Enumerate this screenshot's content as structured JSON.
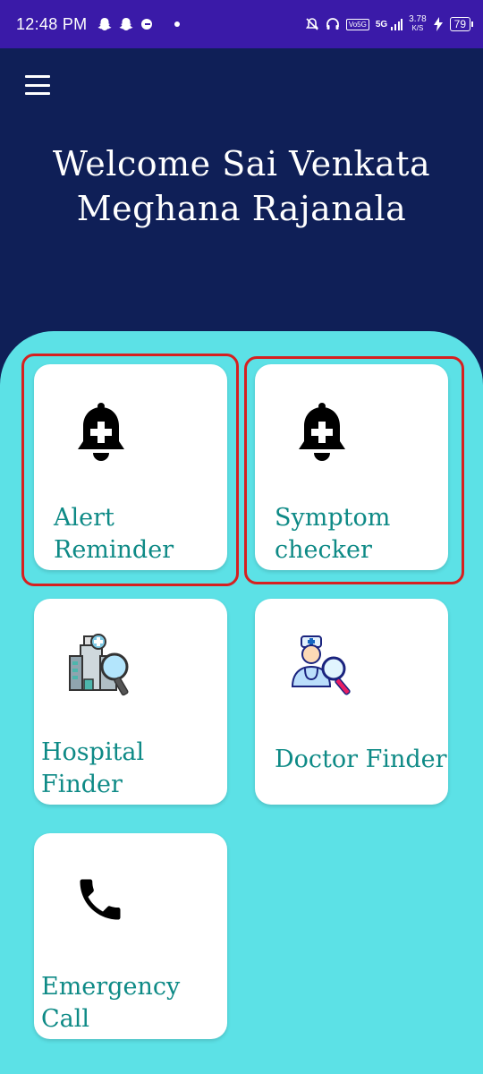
{
  "status_bar": {
    "time": "12:48 PM",
    "network_label": "5G",
    "volte_label": "Vo5G",
    "speed_value": "3.78",
    "speed_unit": "K/S",
    "battery": "79"
  },
  "header": {
    "title_line1": "Welcome Sai Venkata",
    "title_line2": "Meghana Rajanala"
  },
  "cards": [
    {
      "label_line1": "Alert",
      "label_line2": "Reminder",
      "icon": "bell-plus-icon",
      "highlighted": true
    },
    {
      "label_line1": "Symptom",
      "label_line2": "checker",
      "icon": "bell-plus-icon",
      "highlighted": true
    },
    {
      "label_line1": "Hospital",
      "label_line2": "Finder",
      "icon": "hospital-search-icon",
      "highlighted": false
    },
    {
      "label_line1": "Doctor Finder",
      "label_line2": "",
      "icon": "doctor-search-icon",
      "highlighted": false
    },
    {
      "label_line1": "Emergency",
      "label_line2": "Call",
      "icon": "phone-icon",
      "highlighted": false
    }
  ],
  "colors": {
    "header_bg": "#0f1f57",
    "status_bar_bg": "#3a1aa8",
    "panel_bg": "#5ce1e6",
    "card_text": "#0e8a86",
    "highlight_border": "#d62020"
  }
}
